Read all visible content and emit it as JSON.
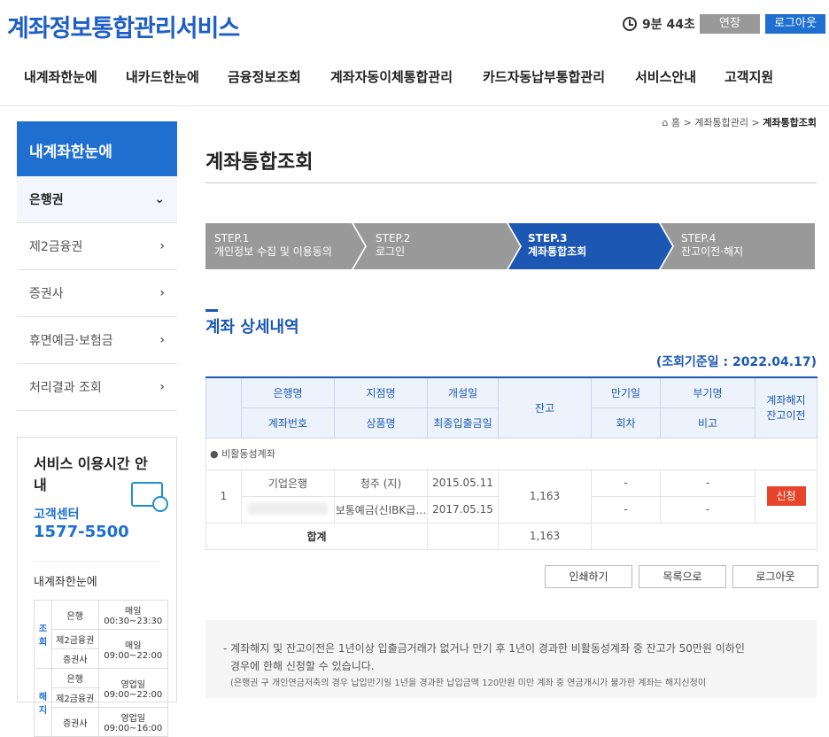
{
  "header": {
    "title": "계좌정보통합관리서비스",
    "timer": "9분 44초",
    "extend_label": "연장",
    "logout_label": "로그아웃"
  },
  "gnb": [
    "내계좌한눈에",
    "내카드한눈에",
    "금융정보조회",
    "계좌자동이체통합관리",
    "카드자동납부통합관리",
    "서비스안내",
    "고객지원"
  ],
  "sidebar": {
    "title": "내계좌한눈에",
    "items": [
      {
        "label": "은행권",
        "chevron": "⌄"
      },
      {
        "label": "제2금융권",
        "chevron": "›"
      },
      {
        "label": "증권사",
        "chevron": "›"
      },
      {
        "label": "휴면예금·보험금",
        "chevron": "›"
      },
      {
        "label": "처리결과 조회",
        "chevron": "›"
      }
    ]
  },
  "service": {
    "title": "서비스 이용시간 안내",
    "cc_label": "고객센터",
    "cc_number": "1577-5500",
    "sub_title": "내계좌한눈에",
    "rows": [
      {
        "group": "조회",
        "org": "은행",
        "time": "매일\n00:30~23:30"
      },
      {
        "group": "",
        "org": "제2금융권",
        "time": "매일\n09:00~22:00"
      },
      {
        "group": "",
        "org": "증권사",
        "time": ""
      },
      {
        "group": "해지",
        "org": "은행",
        "time": "영업일\n09:00~22:00"
      },
      {
        "group": "",
        "org": "제2금융권",
        "time": ""
      },
      {
        "group": "",
        "org": "증권사",
        "time": "영업일\n09:00~16:00"
      }
    ]
  },
  "breadcrumb": {
    "home": "홈",
    "mid": "계좌통합관리",
    "current": "계좌통합조회"
  },
  "page_title": "계좌통합조회",
  "steps": [
    {
      "num": "STEP.1",
      "label": "개인정보 수집 및 이용동의"
    },
    {
      "num": "STEP.2",
      "label": "로그인"
    },
    {
      "num": "STEP.3",
      "label": "계좌통합조회"
    },
    {
      "num": "STEP.4",
      "label": "잔고이전·해지"
    }
  ],
  "section_title": "계좌 상세내역",
  "base_date": "(조회기준일 : 2022.04.17)",
  "table": {
    "h_bank": "은행명",
    "h_acct": "계좌번호",
    "h_branch": "지점명",
    "h_product": "상품명",
    "h_open": "개설일",
    "h_last": "최종입출금일",
    "h_balance": "잔고",
    "h_maturity": "만기일",
    "h_round": "회차",
    "h_sub": "부기명",
    "h_note": "비고",
    "h_action": "계좌해지\n잔고이전",
    "group": "비활동성계좌",
    "row": {
      "no": "1",
      "bank": "기업은행",
      "branch": "청주 (지)",
      "open": "2015.05.11",
      "product": "보통예금(신IBK급…",
      "last": "2017.05.15",
      "balance": "1,163",
      "maturity": "-",
      "round": "-",
      "sub": "-",
      "note": "-",
      "action": "신청"
    },
    "total_label": "합계",
    "total": "1,163"
  },
  "buttons": {
    "print": "인쇄하기",
    "list": "목록으로",
    "logout": "로그아웃"
  },
  "notice": {
    "line1": "- 계좌해지 및 잔고이전은 1년이상 입출금거래가 없거나 만기 후 1년이 경과한 비활동성계좌 중 잔고가 50만원 이하인",
    "line2": "경우에 한해 신청할 수 있습니다.",
    "line3": "(은행권 구 개인연금저축의 경우 납입만기일 1년을 경과한 납입금액 120만원 미만 계좌 중 연금개시가 불가한 계좌는 해지신청이"
  }
}
